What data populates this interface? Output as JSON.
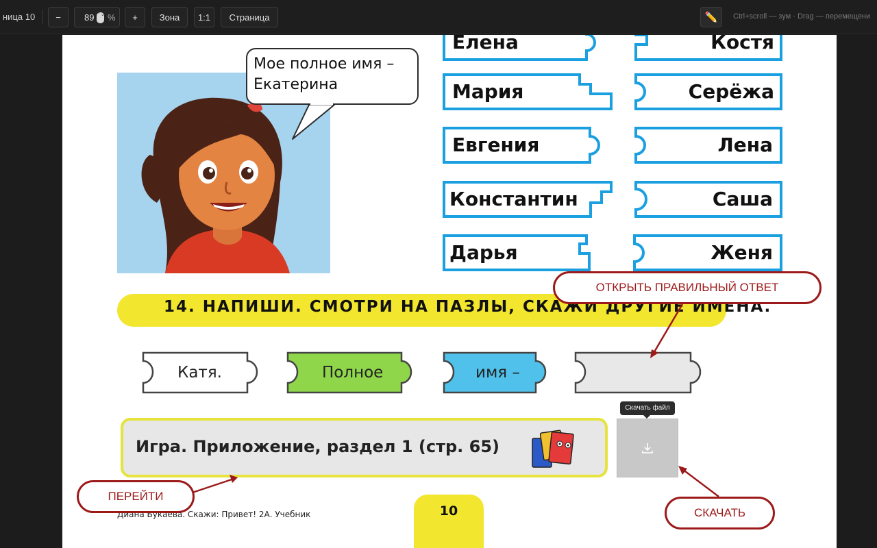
{
  "toolbar": {
    "page_indicator": "ница 10",
    "zoom_out": "−",
    "zoom_value": "89",
    "zoom_spinner": "⌃⌄",
    "zoom_unit": "%",
    "zoom_in": "+",
    "zone": "Зона",
    "actual_size": "1:1",
    "page_fit": "Страница",
    "hint": "Ctrl+scroll — зум · Drag — перемещени"
  },
  "speech_bubble": "Мое полное имя – Екатерина",
  "puzzles": {
    "left": [
      "Елена",
      "Мария",
      "Евгения",
      "Константин",
      "Дарья"
    ],
    "right": [
      "Костя",
      "Серёжа",
      "Лена",
      "Саша",
      "Женя"
    ]
  },
  "task": {
    "title": "14. НАПИШИ. СМОТРИ НА ПАЗЛЫ, СКАЖИ ДРУГИЕ ИМЕНА."
  },
  "bottom_puzzles": [
    {
      "label": "Катя.",
      "color": "#ffffff"
    },
    {
      "label": "Полное",
      "color": "#8fd64a"
    },
    {
      "label": "имя –",
      "color": "#4fc1ea"
    },
    {
      "label": "",
      "color": "#e8e8e8"
    }
  ],
  "game_button": {
    "label": "Игра. Приложение, раздел 1 (стр. 65)"
  },
  "download": {
    "tooltip": "Скачать файл",
    "icon": "download-icon"
  },
  "callouts": {
    "open_answer": "ОТКРЫТЬ ПРАВИЛЬНЫЙ ОТВЕТ",
    "go": "ПЕРЕЙТИ",
    "download": "СКАЧАТЬ"
  },
  "footer": {
    "text": "Диана Букаева. Скажи: Привет! 2А. Учебник",
    "page_number": "10"
  },
  "colors": {
    "puzzle_border": "#1aa0e0",
    "banner_yellow": "#f2e62f",
    "callout_red": "#9c1a1a"
  }
}
